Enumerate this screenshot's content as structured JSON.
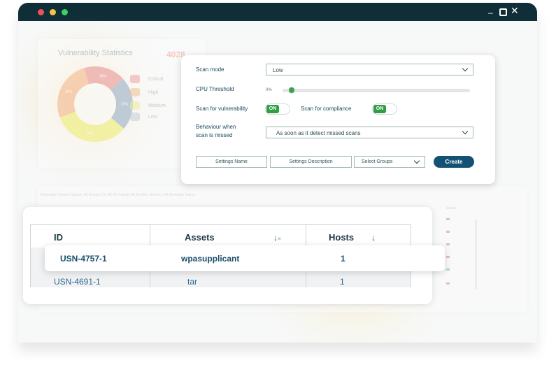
{
  "window": {
    "controls": {
      "minimize": "_",
      "close": "✕"
    }
  },
  "dashboard": {
    "stats_title": "Vulnerability Statistics",
    "stats_count": "4028",
    "donut_segments": [
      {
        "label": "18%",
        "value": 18,
        "color": "#e88a8a"
      },
      {
        "label": "23%",
        "value": 23,
        "color": "#8fa7c2"
      },
      {
        "label": "33%",
        "value": 33,
        "color": "#ecec6a"
      },
      {
        "label": "26%",
        "value": 26,
        "color": "#f2b182"
      }
    ],
    "legend": [
      {
        "label": "Critical",
        "color": "#eba6a6"
      },
      {
        "label": "High",
        "color": "#f1c29a"
      },
      {
        "label": "Medium",
        "color": "#ececa2"
      },
      {
        "label": "Low",
        "color": "#c3cfde"
      }
    ],
    "filters_row": "Vulnerable Devices   Source: All Groups   OS: All OS   Family: All Families   Severity: All Severities   Status:",
    "status_header": "Status"
  },
  "settings": {
    "scan_mode_label": "Scan mode",
    "scan_mode_value": "Low",
    "cpu_label": "CPU Threshold",
    "cpu_value_text": "0%",
    "cpu_value": 0.05,
    "scan_vuln_label": "Scan for vulnerability",
    "scan_vuln_state": "ON",
    "scan_compliance_label": "Scan for compliance",
    "scan_compliance_state": "ON",
    "behaviour_label_1": "Behaviour when",
    "behaviour_label_2": "scan is missed",
    "behaviour_value": "As soon as it detect missed scans",
    "settings_name_btn": "Settings Name",
    "settings_desc_btn": "Settings Description",
    "select_groups": "Select Groups",
    "create_btn": "Create"
  },
  "table": {
    "headers": {
      "id": "ID",
      "assets": "Assets",
      "hosts": "Hosts"
    },
    "rows": [
      {
        "id": "USN-4757-1",
        "asset": "wpasupplicant",
        "hosts": "1"
      },
      {
        "id": "USN-4691-1",
        "asset": "tar",
        "hosts": "1"
      }
    ]
  }
}
